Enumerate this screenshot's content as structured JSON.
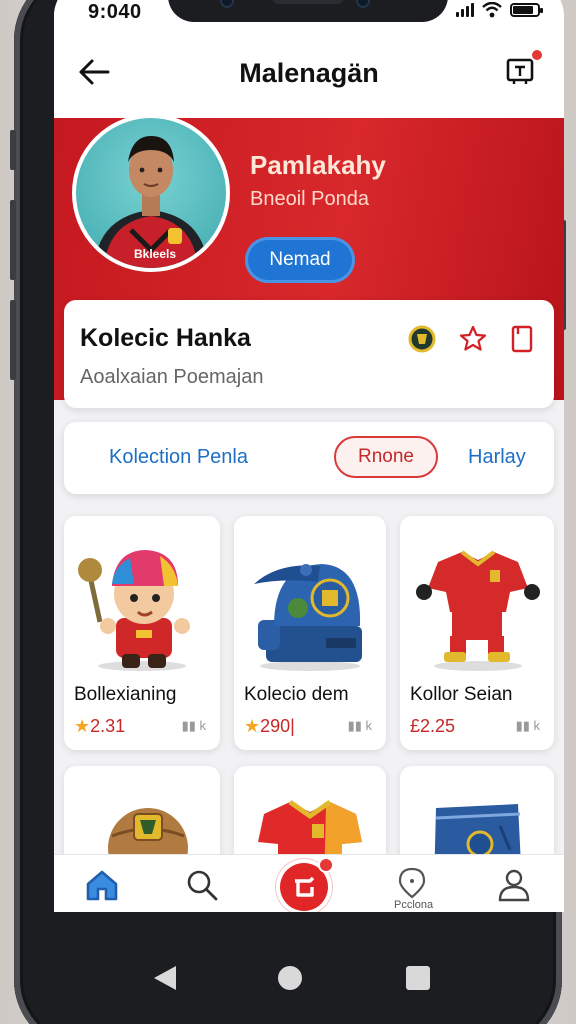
{
  "status": {
    "time": "9:040"
  },
  "header": {
    "title": "Malenagän"
  },
  "hero": {
    "name": "Pamlakahy",
    "subtitle": "Bneoil Ponda",
    "button": "Nemad",
    "jersey_text": "Bkleels"
  },
  "info": {
    "title": "Kolecic Hanka",
    "subtitle": "Aoalxaian  Poemajan"
  },
  "tabs": {
    "left": "Kolection Penla",
    "active": "Rnone",
    "right": "Harlay"
  },
  "products": [
    {
      "name": "Bollexianing",
      "price": "2.31",
      "meta": "▮▮ k"
    },
    {
      "name": "Kolecio dem",
      "price": "290|",
      "meta": "▮▮ k"
    },
    {
      "name": "Kollor Seian",
      "price": "£2.25",
      "meta": "▮▮ k"
    }
  ],
  "bottom_nav": {
    "label": "Pcclona"
  },
  "colors": {
    "brand_red": "#d32027",
    "accent_blue": "#1f74d4"
  }
}
